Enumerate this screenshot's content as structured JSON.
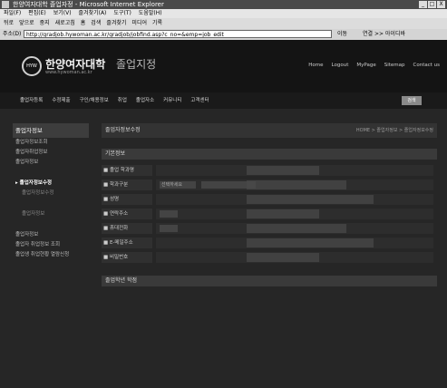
{
  "window": {
    "title": "한양여자대학 졸업자정 - Microsoft Internet Explorer",
    "controls": [
      "_",
      "□",
      "X"
    ]
  },
  "menubar": [
    "파일(F)",
    "편집(E)",
    "보기(V)",
    "즐겨찾기(A)",
    "도구(T)",
    "도움말(H)"
  ],
  "toolbar": [
    "뒤로",
    "앞으로",
    "중지",
    "새로고침",
    "홈",
    "검색",
    "즐겨찾기",
    "미디어",
    "기록"
  ],
  "addressbar": {
    "label": "주소(D)",
    "url": "http://gradjob.hywoman.ac.kr/gradjob/jobfind.asp?c_no=&emp=job_edit",
    "go": "이동",
    "links": "연결 >> 아이디바"
  },
  "site": {
    "logo_mark": "HYW",
    "name": "한양여자대학",
    "sub": "졸업지정",
    "url": "www.hywoman.ac.kr",
    "toplinks": [
      "Home",
      "Logout",
      "MyPage",
      "Sitemap",
      "Contact us"
    ]
  },
  "gnb": {
    "items": [
      "졸업자등록",
      "수정제출",
      "구인/채용정보",
      "취업",
      "졸업자소",
      "커뮤니티",
      "고객센터"
    ],
    "tag": "검색"
  },
  "lnb": {
    "head": "졸업자정보",
    "items": [
      {
        "label": "졸업자정보조회",
        "type": "item"
      },
      {
        "label": "졸업자취업정보",
        "type": "item"
      },
      {
        "label": "졸업자정보",
        "type": "item"
      },
      {
        "label": "",
        "type": "gap"
      },
      {
        "label": "▸ 졸업자정보수정",
        "type": "active"
      },
      {
        "label": "졸업자정보수정",
        "type": "sub"
      },
      {
        "label": "",
        "type": "gap"
      },
      {
        "label": "졸업자정보",
        "type": "sub"
      },
      {
        "label": "",
        "type": "gap"
      },
      {
        "label": "졸업자정보",
        "type": "item"
      },
      {
        "label": "졸업자 취업정보 조회",
        "type": "item"
      },
      {
        "label": "졸업생 취업현황 열람신청",
        "type": "item"
      }
    ]
  },
  "content": {
    "title": "졸업자정보수정",
    "breadcrumb": "HOME > 졸업자정보 > 졸업자정보수정",
    "section1": "기본정보",
    "rows": [
      {
        "label": "■ 졸업 학과명",
        "value": ""
      },
      {
        "label": "■ 학과구분",
        "value": "선택하세요"
      },
      {
        "label": "■ 성명",
        "value": ""
      },
      {
        "label": "■ 연락주소",
        "value": ""
      },
      {
        "label": "■ 휴대전화",
        "value": ""
      },
      {
        "label": "■ E-메일주소",
        "value": ""
      },
      {
        "label": "■ 비밀번호",
        "value": ""
      }
    ],
    "section2": "졸업학년 학점"
  }
}
